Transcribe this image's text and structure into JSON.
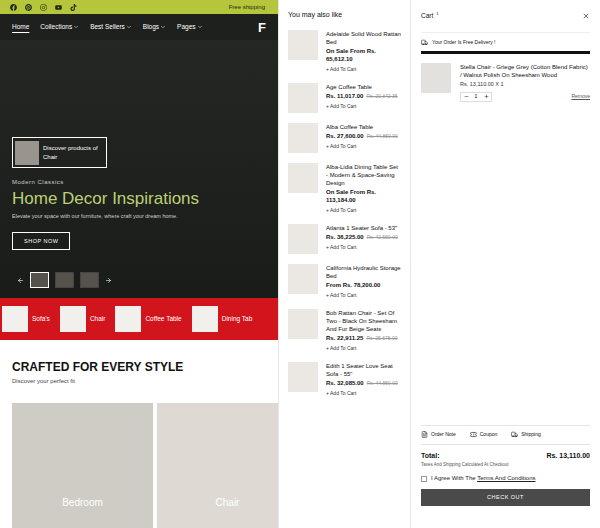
{
  "announcement": {
    "text": "Free shipping"
  },
  "nav": {
    "logo": "F",
    "items": [
      {
        "label": "Home",
        "selected": true,
        "has_menu": false
      },
      {
        "label": "Collections",
        "selected": false,
        "has_menu": true
      },
      {
        "label": "Best Sellers",
        "selected": false,
        "has_menu": true
      },
      {
        "label": "Blogs",
        "selected": false,
        "has_menu": true
      },
      {
        "label": "Pages",
        "selected": false,
        "has_menu": true
      }
    ]
  },
  "hero": {
    "discover": {
      "line1": "Discover products of",
      "line2": "Chair"
    },
    "eyebrow": "Modern Classics",
    "title": "Home Decor Inspirations",
    "subtitle": "Elevate your space with our furniture, where craft your dream home.",
    "button": "SHOP NOW",
    "thumbnails": [
      {
        "selected": true
      },
      {
        "selected": false
      },
      {
        "selected": false
      }
    ]
  },
  "categories": [
    {
      "label": "Sofa's"
    },
    {
      "label": "Chair"
    },
    {
      "label": "Coffee Table"
    },
    {
      "label": "Dining Tab"
    }
  ],
  "section": {
    "title": "CRAFTED FOR EVERY STYLE",
    "subtitle": "Discover your perfect fit",
    "cards": [
      {
        "label": "Bedroom"
      },
      {
        "label": "Chair"
      }
    ]
  },
  "recommendations": {
    "title": "You may also like",
    "items": [
      {
        "name": "Adelaide Solid Wood Rattan Bed",
        "price": "On Sale From Rs. 65,612.10",
        "action": "+ Add To Cart"
      },
      {
        "name": "Age Coffee Table",
        "price": "Rs. 11,017.00",
        "compare_price": "Rs. 20,342.35",
        "action": "+ Add To Cart"
      },
      {
        "name": "Alba Coffee Table",
        "price": "Rs. 27,600.00",
        "compare_price": "Rs. 44,850.00",
        "action": "+ Add To Cart"
      },
      {
        "name": "Alba-Lidia Dining Table Set - Modern & Space-Saving Design",
        "price": "On Sale From Rs. 113,184.00",
        "action": "+ Add To Cart"
      },
      {
        "name": "Atlanta 1 Seater Sofa - 53\"",
        "price": "Rs. 36,225.00",
        "compare_price": "Rs. 42,550.00",
        "action": "+ Add To Cart"
      },
      {
        "name": "California Hydraulic Storage Bed",
        "price": "From Rs. 78,200.00",
        "action": "+ Add To Cart"
      },
      {
        "name": "Bob Rattan Chair - Set Of Two - Black On Sheesham And Fur Beige Seats",
        "price": "Rs. 22,911.25",
        "compare_price": "Rs. 25,675.00",
        "action": "+ Add To Cart"
      },
      {
        "name": "Edith 1 Seater Love Seat Sofa - 55\"",
        "price": "Rs. 32,085.00",
        "compare_price": "Rs. 44,850.00",
        "action": "+ Add To Cart"
      }
    ]
  },
  "cart": {
    "title": "Cart",
    "count": "1",
    "delivery": {
      "text": "Your Order Is Free Delivery !",
      "level": 1
    },
    "items": [
      {
        "name": "Stella Chair - Griege Grey (Cotton Blend Fabric) / Walnut Polish On Sheesham Wood",
        "price": "Rs. 13,110.00 X 1",
        "quantity": "1",
        "remove": "Remove"
      }
    ],
    "tools": [
      {
        "label": "Order Note",
        "kind": "note"
      },
      {
        "label": "Coupon",
        "kind": "coupon"
      },
      {
        "label": "Shipping",
        "kind": "shipping"
      }
    ],
    "total_label": "Total:",
    "total": "Rs. 13,110.00",
    "note": "Taxes And Shipping Calculated At Checkout",
    "agree": {
      "text": "I Agree With The ",
      "link": "Terms And Conditions",
      "checked": false
    },
    "checkout": "CHECK OUT"
  }
}
